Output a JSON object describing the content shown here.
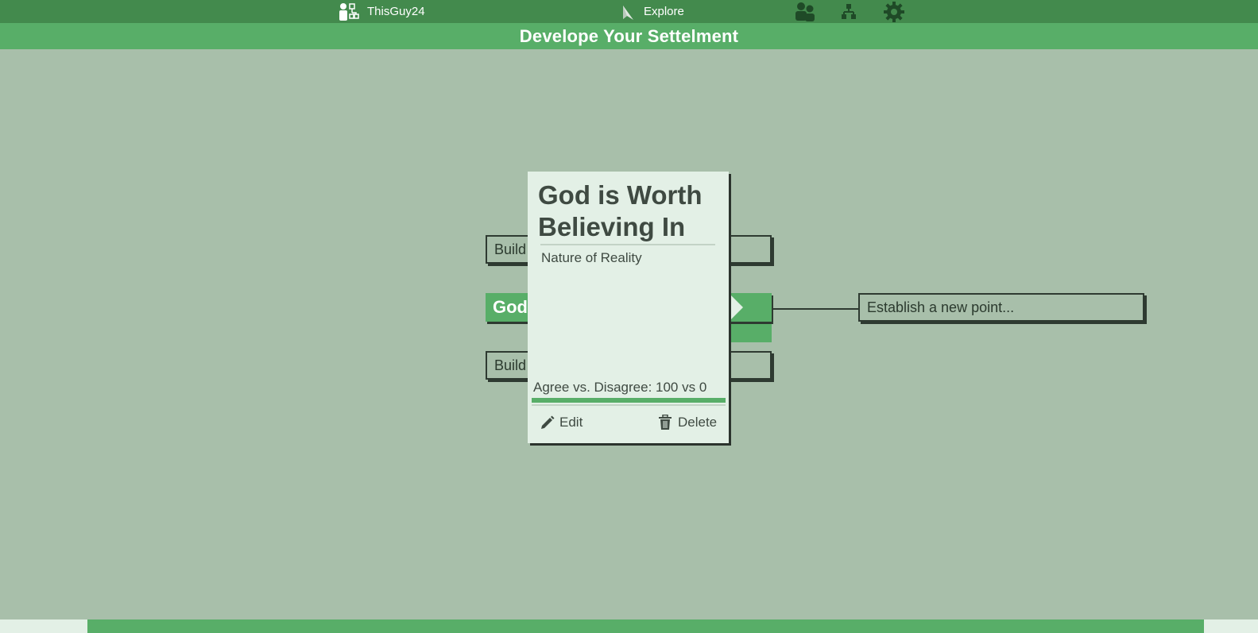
{
  "topbar": {
    "username": "ThisGuy24",
    "explore_label": "Explore",
    "icons": [
      "user-tree-icon",
      "compass-icon",
      "people-icon",
      "hierarchy-icon",
      "gear-icon"
    ]
  },
  "page": {
    "title": "Develope Your Settelment"
  },
  "tree": {
    "top_node_label": "Build",
    "selected_node_label": "God",
    "bottom_node_label": "Build",
    "new_point_placeholder": "Establish a new point..."
  },
  "popup": {
    "title": "God is Worth Believing In",
    "category": "Nature of Reality",
    "score_text": "Agree vs. Disagree: 100 vs 0",
    "agree_fraction": 1.0,
    "edit_label": "Edit",
    "delete_label": "Delete"
  },
  "colors": {
    "topbar": "#438a4d",
    "accent": "#58ae68",
    "canvas": "#a8bfaa",
    "card": "#e3f0e6",
    "text": "#3f4a42"
  }
}
